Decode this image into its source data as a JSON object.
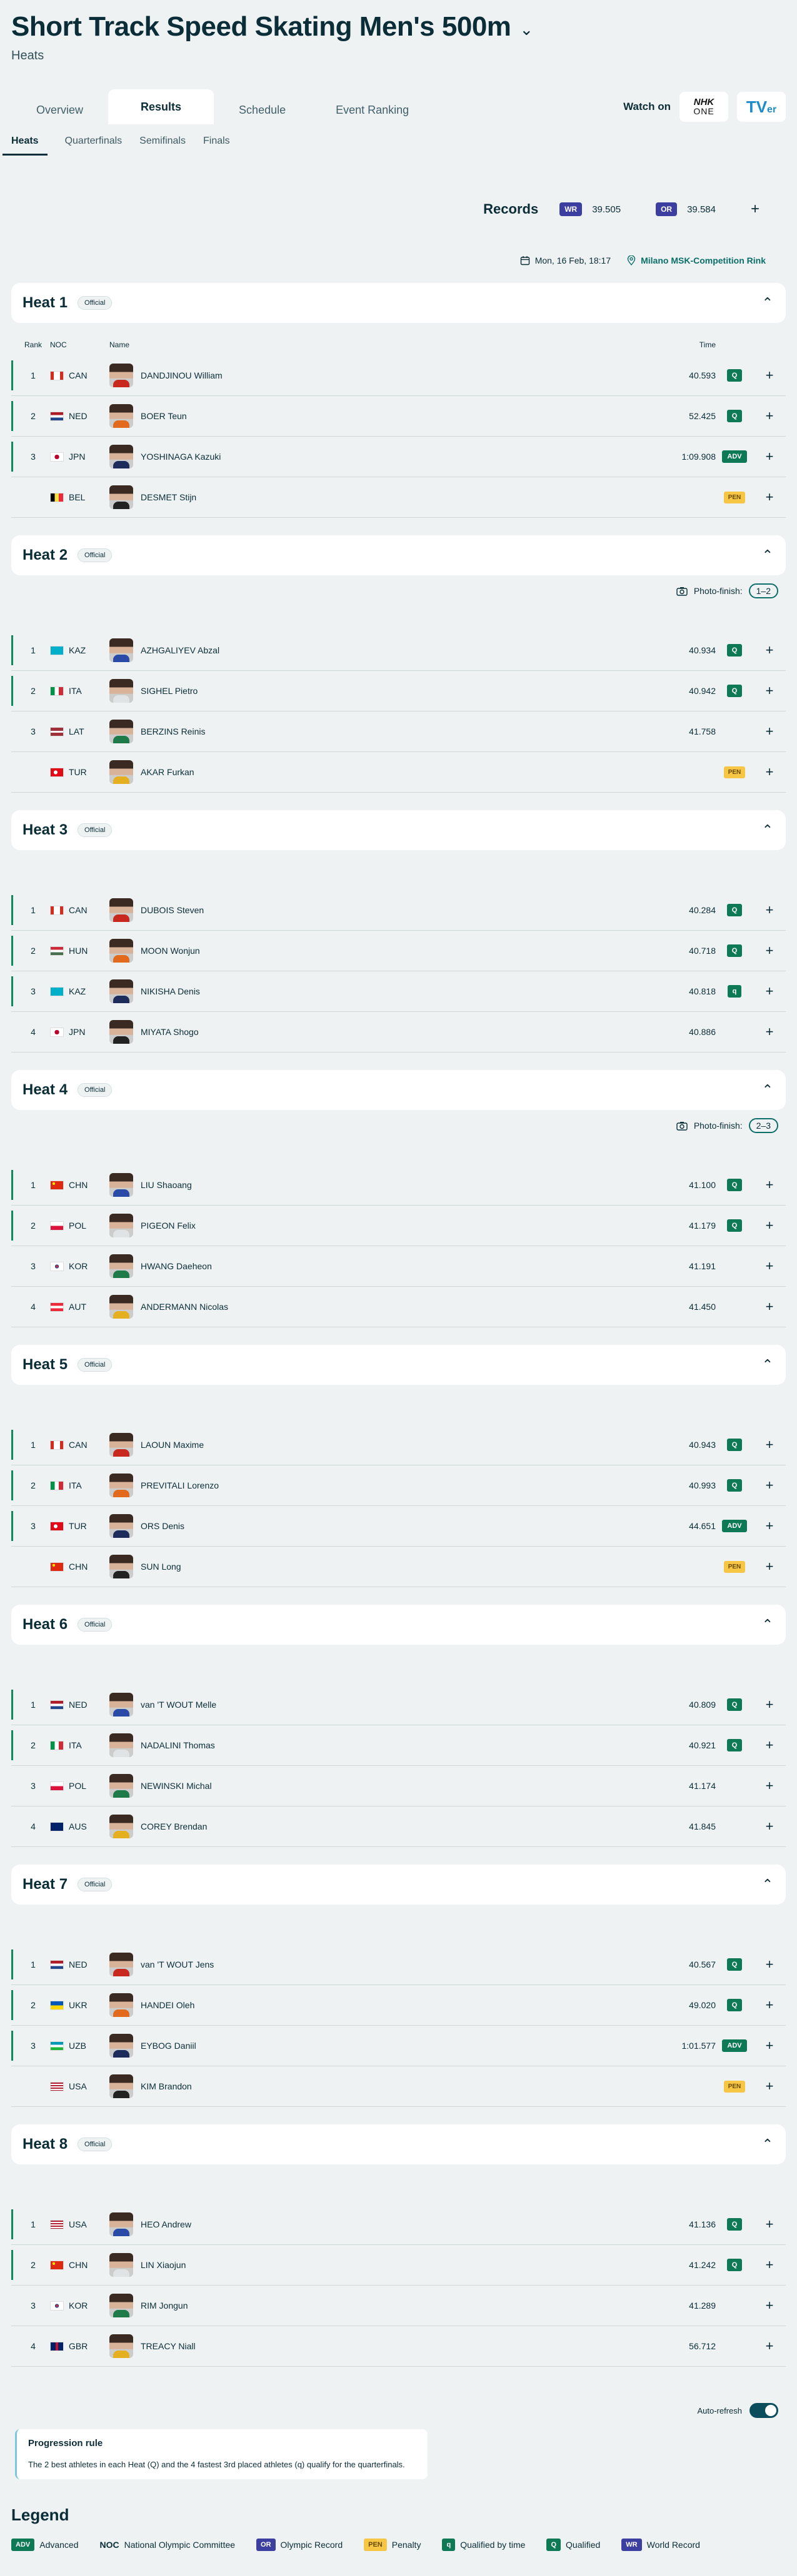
{
  "header": {
    "title": "Short Track Speed Skating Men's 500m",
    "subtitle": "Heats"
  },
  "main_tabs": [
    {
      "label": "Overview"
    },
    {
      "label": "Results"
    },
    {
      "label": "Schedule"
    },
    {
      "label": "Event Ranking"
    }
  ],
  "watch": {
    "label": "Watch on",
    "nhk_top": "NHK",
    "nhk_bottom": "ONE",
    "tver": "TV",
    "tver_suffix": "er"
  },
  "sub_tabs": [
    {
      "label": "Heats"
    },
    {
      "label": "Quarterfinals"
    },
    {
      "label": "Semifinals"
    },
    {
      "label": "Finals"
    }
  ],
  "records": {
    "label": "Records",
    "wr_badge": "WR",
    "wr_value": "39.505",
    "or_badge": "OR",
    "or_value": "39.584"
  },
  "meta": {
    "date": "Mon, 16 Feb, 18:17",
    "venue": "Milano MSK-Competition Rink"
  },
  "columns": {
    "rank": "Rank",
    "noc": "NOC",
    "name": "Name",
    "time": "Time"
  },
  "official_label": "Official",
  "photo_finish_label": "Photo-finish:",
  "heats": [
    {
      "title": "Heat 1",
      "photo_finish": "",
      "rows": [
        {
          "rank": "1",
          "noc": "CAN",
          "name": "DANDJINOU William",
          "time": "40.593",
          "badge": "Q"
        },
        {
          "rank": "2",
          "noc": "NED",
          "name": "BOER Teun",
          "time": "52.425",
          "badge": "Q"
        },
        {
          "rank": "3",
          "noc": "JPN",
          "name": "YOSHINAGA Kazuki",
          "time": "1:09.908",
          "badge": "ADV"
        },
        {
          "rank": "",
          "noc": "BEL",
          "name": "DESMET Stijn",
          "time": "",
          "badge": "PEN"
        }
      ]
    },
    {
      "title": "Heat 2",
      "photo_finish": "1–2",
      "rows": [
        {
          "rank": "1",
          "noc": "KAZ",
          "name": "AZHGALIYEV Abzal",
          "time": "40.934",
          "badge": "Q"
        },
        {
          "rank": "2",
          "noc": "ITA",
          "name": "SIGHEL Pietro",
          "time": "40.942",
          "badge": "Q"
        },
        {
          "rank": "3",
          "noc": "LAT",
          "name": "BERZINS Reinis",
          "time": "41.758",
          "badge": ""
        },
        {
          "rank": "",
          "noc": "TUR",
          "name": "AKAR Furkan",
          "time": "",
          "badge": "PEN"
        }
      ]
    },
    {
      "title": "Heat 3",
      "photo_finish": "",
      "rows": [
        {
          "rank": "1",
          "noc": "CAN",
          "name": "DUBOIS Steven",
          "time": "40.284",
          "badge": "Q"
        },
        {
          "rank": "2",
          "noc": "HUN",
          "name": "MOON Wonjun",
          "time": "40.718",
          "badge": "Q"
        },
        {
          "rank": "3",
          "noc": "KAZ",
          "name": "NIKISHA Denis",
          "time": "40.818",
          "badge": "q"
        },
        {
          "rank": "4",
          "noc": "JPN",
          "name": "MIYATA Shogo",
          "time": "40.886",
          "badge": ""
        }
      ]
    },
    {
      "title": "Heat 4",
      "photo_finish": "2–3",
      "rows": [
        {
          "rank": "1",
          "noc": "CHN",
          "name": "LIU Shaoang",
          "time": "41.100",
          "badge": "Q"
        },
        {
          "rank": "2",
          "noc": "POL",
          "name": "PIGEON Felix",
          "time": "41.179",
          "badge": "Q"
        },
        {
          "rank": "3",
          "noc": "KOR",
          "name": "HWANG Daeheon",
          "time": "41.191",
          "badge": ""
        },
        {
          "rank": "4",
          "noc": "AUT",
          "name": "ANDERMANN Nicolas",
          "time": "41.450",
          "badge": ""
        }
      ]
    },
    {
      "title": "Heat 5",
      "photo_finish": "",
      "rows": [
        {
          "rank": "1",
          "noc": "CAN",
          "name": "LAOUN Maxime",
          "time": "40.943",
          "badge": "Q"
        },
        {
          "rank": "2",
          "noc": "ITA",
          "name": "PREVITALI Lorenzo",
          "time": "40.993",
          "badge": "Q"
        },
        {
          "rank": "3",
          "noc": "TUR",
          "name": "ORS Denis",
          "time": "44.651",
          "badge": "ADV"
        },
        {
          "rank": "",
          "noc": "CHN",
          "name": "SUN Long",
          "time": "",
          "badge": "PEN"
        }
      ]
    },
    {
      "title": "Heat 6",
      "photo_finish": "",
      "rows": [
        {
          "rank": "1",
          "noc": "NED",
          "name": "van 'T WOUT Melle",
          "time": "40.809",
          "badge": "Q"
        },
        {
          "rank": "2",
          "noc": "ITA",
          "name": "NADALINI Thomas",
          "time": "40.921",
          "badge": "Q"
        },
        {
          "rank": "3",
          "noc": "POL",
          "name": "NEWINSKI Michal",
          "time": "41.174",
          "badge": ""
        },
        {
          "rank": "4",
          "noc": "AUS",
          "name": "COREY Brendan",
          "time": "41.845",
          "badge": ""
        }
      ]
    },
    {
      "title": "Heat 7",
      "photo_finish": "",
      "rows": [
        {
          "rank": "1",
          "noc": "NED",
          "name": "van 'T WOUT Jens",
          "time": "40.567",
          "badge": "Q"
        },
        {
          "rank": "2",
          "noc": "UKR",
          "name": "HANDEI Oleh",
          "time": "49.020",
          "badge": "Q"
        },
        {
          "rank": "3",
          "noc": "UZB",
          "name": "EYBOG Daniil",
          "time": "1:01.577",
          "badge": "ADV"
        },
        {
          "rank": "",
          "noc": "USA",
          "name": "KIM Brandon",
          "time": "",
          "badge": "PEN"
        }
      ]
    },
    {
      "title": "Heat 8",
      "photo_finish": "",
      "rows": [
        {
          "rank": "1",
          "noc": "USA",
          "name": "HEO Andrew",
          "time": "41.136",
          "badge": "Q"
        },
        {
          "rank": "2",
          "noc": "CHN",
          "name": "LIN Xiaojun",
          "time": "41.242",
          "badge": "Q"
        },
        {
          "rank": "3",
          "noc": "KOR",
          "name": "RIM Jongun",
          "time": "41.289",
          "badge": ""
        },
        {
          "rank": "4",
          "noc": "GBR",
          "name": "TREACY Niall",
          "time": "56.712",
          "badge": ""
        }
      ]
    }
  ],
  "auto_refresh": "Auto-refresh",
  "progression": {
    "title": "Progression rule",
    "text": "The 2 best athletes in each Heat (Q) and the 4 fastest 3rd placed athletes (q) qualify for the quarterfinals."
  },
  "legend": {
    "title": "Legend",
    "items": [
      {
        "code": "ADV",
        "text": "Advanced"
      },
      {
        "code": "NOC",
        "text": "National Olympic Committee"
      },
      {
        "code": "OR",
        "text": "Olympic Record"
      },
      {
        "code": "PEN",
        "text": "Penalty"
      },
      {
        "code": "q",
        "text": "Qualified by time"
      },
      {
        "code": "Q",
        "text": "Qualified"
      },
      {
        "code": "WR",
        "text": "World Record"
      }
    ]
  },
  "colors": {
    "accent": "#0b6e6a",
    "qualified": "#0d7a55",
    "record": "#3d3fa0",
    "penalty": "#f6c644",
    "background": "#eef2f2"
  }
}
